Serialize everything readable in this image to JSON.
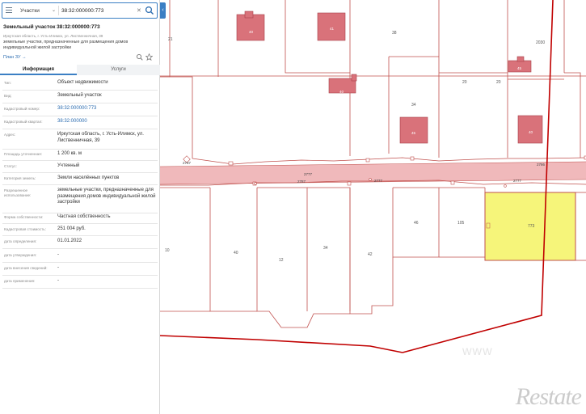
{
  "search": {
    "layer_label": "Участки",
    "value": "38:32:000000:773"
  },
  "parcel": {
    "title": "Земельный участок 38:32:000000:773",
    "address_short": "Иркутская область, г. Усть-Илимск, ул. Лиственничная, 39",
    "description": "земельные участки, предназначенные для размещения домов индивидуальной жилой застройки",
    "plan_link": "План ЗУ →"
  },
  "tabs": [
    {
      "label": "Информация",
      "active": true
    },
    {
      "label": "Услуги",
      "active": false
    }
  ],
  "properties": [
    {
      "label": "Тип:",
      "value": "Объект недвижимости",
      "link": false
    },
    {
      "label": "Вид:",
      "value": "Земельный участок",
      "link": false
    },
    {
      "label": "Кадастровый номер:",
      "value": "38:32:000000:773",
      "link": true
    },
    {
      "label": "Кадастровый квартал:",
      "value": "38:32:000000",
      "link": true
    },
    {
      "label": "Адрес:",
      "value": "Иркутская область, г. Усть-Илимск, ул. Лиственничная, 39",
      "link": false
    },
    {
      "label": "Площадь уточненная:",
      "value": "1 200 кв. м",
      "link": false
    },
    {
      "label": "Статус:",
      "value": "Учтенный",
      "link": false
    },
    {
      "label": "Категория земель:",
      "value": "Земли населённых пунктов",
      "link": false
    },
    {
      "label": "Разрешенное использование:",
      "value": "земельные участки, предназначенные для размещения домов индивидуальной жилой застройки",
      "link": false
    },
    {
      "label": "Форма собственности:",
      "value": "Частная собственность",
      "link": false
    },
    {
      "label": "Кадастровая стоимость:",
      "value": "251 004 руб.",
      "link": false
    },
    {
      "label": "дата определения:",
      "value": "01.01.2022",
      "link": false
    },
    {
      "label": "дата утверждения:",
      "value": "-",
      "link": false
    },
    {
      "label": "дата внесения сведений:",
      "value": "-",
      "link": false
    },
    {
      "label": "дата применения:",
      "value": "-",
      "link": false
    }
  ],
  "map": {
    "road_label": "2777",
    "parcel_labels": [
      "21",
      "38",
      "2030",
      "20",
      "20",
      "34",
      "46",
      "105",
      "773",
      "10",
      "40",
      "12",
      "34",
      "42",
      "2787",
      "2787",
      "2777",
      "2777",
      "2786",
      "2777"
    ],
    "building_labels": [
      "40",
      "41",
      "40",
      "45",
      "45",
      "40"
    ],
    "selected_parcel_color": "#f6f57a",
    "parcel_border_color": "#c0504d",
    "building_color": "#d9727a",
    "road_color": "#f0b9bb"
  },
  "watermark": {
    "brand": "Restate",
    "map_mark": "www"
  }
}
